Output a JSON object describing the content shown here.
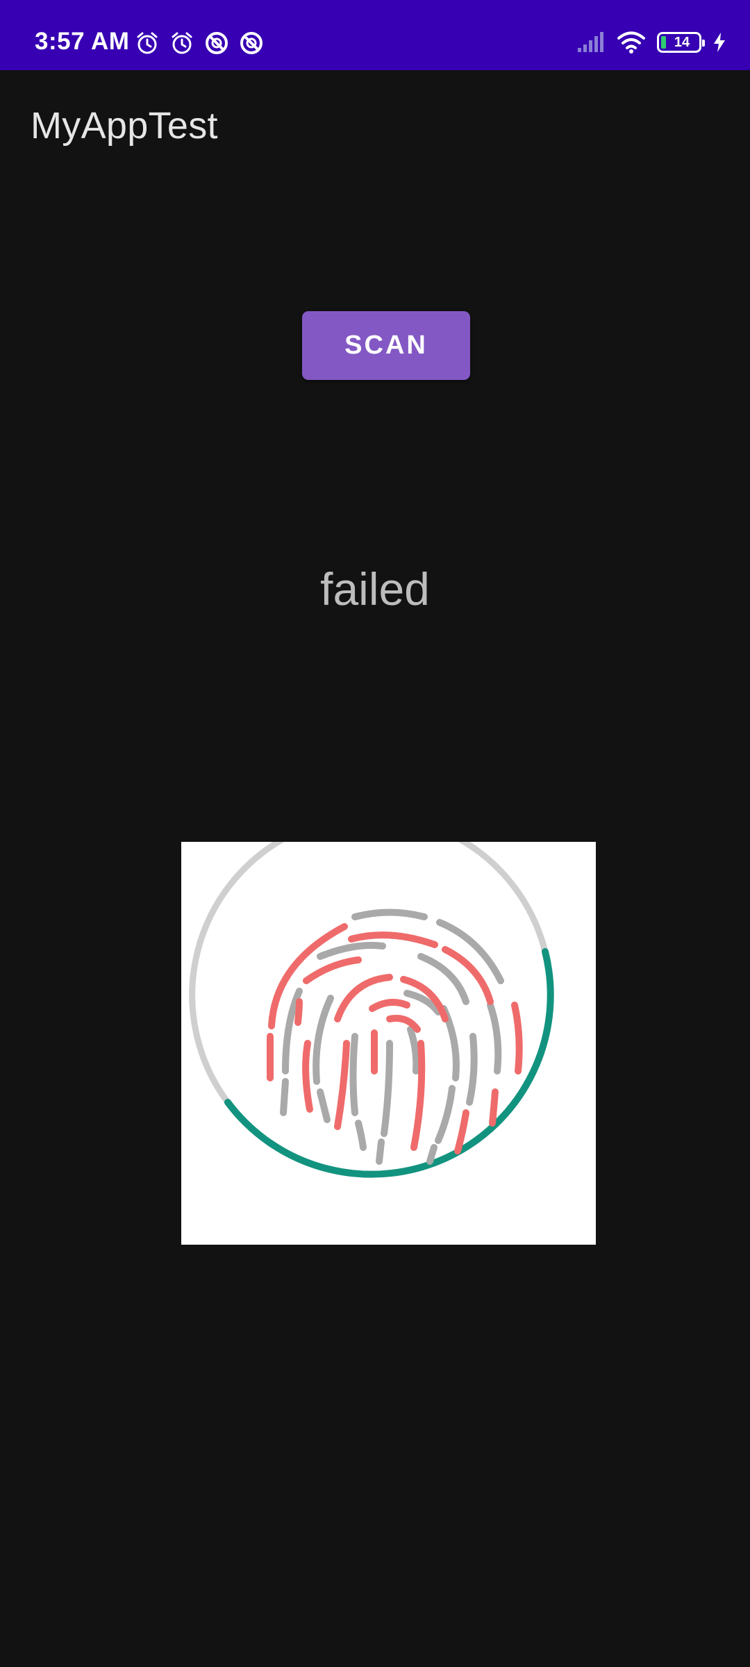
{
  "status_bar": {
    "time": "3:57 AM",
    "battery_level": "14",
    "battery_fraction": 0.14,
    "icons_left": [
      "alarm-icon",
      "alarm-icon",
      "no-disturb-icon",
      "no-disturb-icon"
    ],
    "icons_right": [
      "signal-icon",
      "wifi-icon",
      "battery-icon",
      "charging-bolt-icon"
    ],
    "background": "#3700b3"
  },
  "app_bar": {
    "title": "MyAppTest"
  },
  "main": {
    "scan_button_label": "SCAN",
    "result_text": "failed",
    "image": "fingerprint-icon"
  },
  "colors": {
    "background": "#121212",
    "accent": "#8358c4",
    "fingerprint_fail": "#ef6b6b",
    "fingerprint_ring": "#12937f",
    "fingerprint_gray": "#a9a9a9"
  }
}
